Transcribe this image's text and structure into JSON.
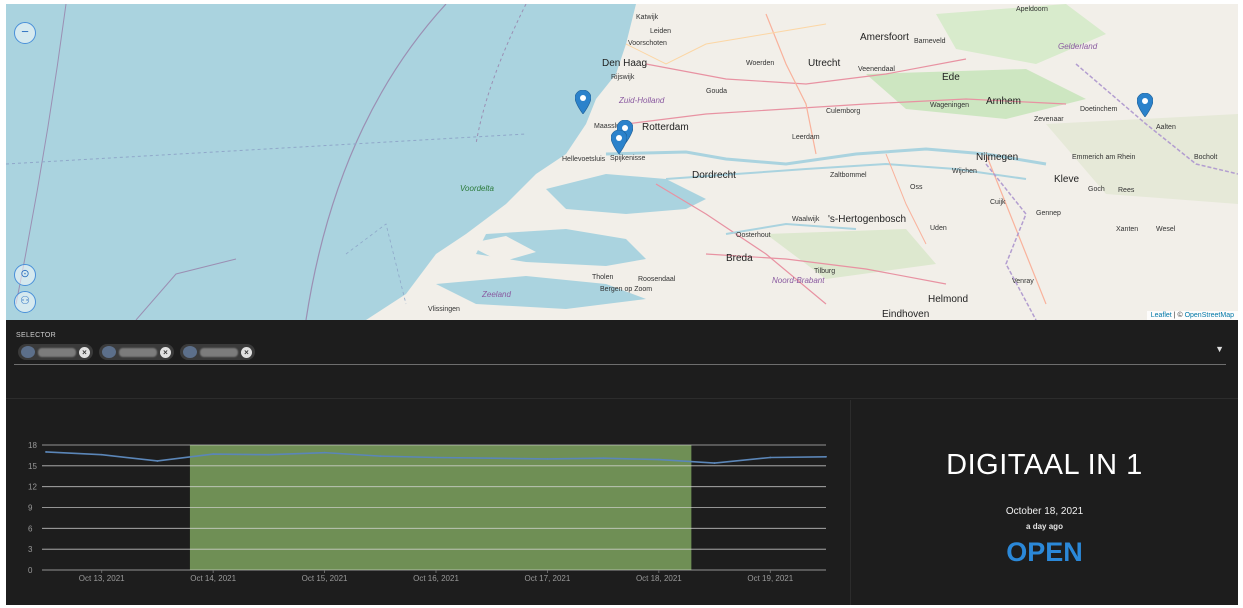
{
  "map": {
    "labels": {
      "katwijk": "Katwijk",
      "leiden": "Leiden",
      "voorschoten": "Voorschoten",
      "den_haag": "Den Haag",
      "rijswijk": "Rijswijk",
      "zuid_holland": "Zuid-Holland",
      "rotterdam": "Rotterdam",
      "maassluis": "Maassluis",
      "spijkenisse": "Spijkenisse",
      "hellevoetsluis": "Hellevoetsluis",
      "dordrecht": "Dordrecht",
      "gouda": "Gouda",
      "utrecht": "Utrecht",
      "amersfoort": "Amersfoort",
      "ede": "Ede",
      "arnhem": "Arnhem",
      "nijmegen": "Nijmegen",
      "wageningen": "Wageningen",
      "doetinchem": "Doetinchem",
      "aalten": "Aalten",
      "gelderland": "Gelderland",
      "kleve": "Kleve",
      "emmerich": "Emmerich am Rhein",
      "bocholt": "Bocholt",
      "s_hertogenbosch": "'s-Hertogenbosch",
      "breda": "Breda",
      "tilburg": "Tilburg",
      "eindhoven": "Eindhoven",
      "helmond": "Helmond",
      "noord_brabant": "Noord-Brabant",
      "roosendaal": "Roosendaal",
      "bergen_op_zoom": "Bergen op Zoom",
      "vlissingen": "Vlissingen",
      "zeeland": "Zeeland",
      "voordelta": "Voordelta",
      "tholen": "Tholen",
      "oss": "Oss",
      "uden": "Uden",
      "goch": "Goch",
      "venray": "Venray",
      "apeldoorn": "Apeldoorn",
      "barneveld": "Barneveld",
      "zevenaar": "Zevenaar",
      "wijchen": "Wijchen",
      "cuijk": "Cuijk",
      "rees": "Rees",
      "wesel": "Wesel",
      "xanten": "Xanten",
      "gennep": "Gennep",
      "veenendaal": "Veenendaal",
      "culemborg": "Culemborg",
      "zaltbommel": "Zaltbommel",
      "woerden": "Woerden",
      "leerdam": "Leerdam",
      "oosterhout": "Oosterhout",
      "waalwijk": "Waalwijk"
    },
    "attribution": {
      "leaflet": "Leaflet",
      "sep": " | © ",
      "osm": "OpenStreetMap"
    },
    "controls": {
      "zoom_out": "−",
      "locate": "⊙",
      "group": "⚇"
    }
  },
  "selector": {
    "label": "SELECTOR",
    "chips": [
      {
        "remove": "×"
      },
      {
        "remove": "×"
      },
      {
        "remove": "×"
      }
    ],
    "dropdown": "▼"
  },
  "chart_data": {
    "type": "line",
    "x": [
      "Oct 12, 2021 12:00",
      "Oct 13, 2021 00:00",
      "Oct 13, 2021 12:00",
      "Oct 14, 2021 00:00",
      "Oct 14, 2021 12:00",
      "Oct 15, 2021 00:00",
      "Oct 15, 2021 12:00",
      "Oct 16, 2021 00:00",
      "Oct 16, 2021 12:00",
      "Oct 17, 2021 00:00",
      "Oct 17, 2021 12:00",
      "Oct 18, 2021 00:00",
      "Oct 18, 2021 12:00",
      "Oct 19, 2021 00:00",
      "Oct 19, 2021 12:00"
    ],
    "series": [
      {
        "values": [
          17.0,
          16.6,
          15.7,
          16.7,
          16.6,
          16.9,
          16.4,
          16.2,
          16.1,
          16.0,
          16.1,
          15.9,
          15.4,
          16.2,
          16.3
        ]
      }
    ],
    "xticks": [
      "Oct 13, 2021",
      "Oct 14, 2021",
      "Oct 15, 2021",
      "Oct 16, 2021",
      "Oct 17, 2021",
      "Oct 18, 2021",
      "Oct 19, 2021"
    ],
    "yticks": [
      0,
      3,
      6,
      9,
      12,
      15,
      18
    ],
    "ylim": [
      0,
      18
    ],
    "highlight": {
      "from": "Oct 13, 2021 19:00",
      "to": "Oct 18, 2021 07:00",
      "color": "#6f8f55"
    },
    "line_color": "#5b86b8",
    "grid": true,
    "xlabel": "",
    "ylabel": ""
  },
  "status": {
    "title": "DIGITAAL IN 1",
    "date": "October 18, 2021",
    "ago": "a day ago",
    "state": "OPEN",
    "state_color": "#2b88d8"
  }
}
